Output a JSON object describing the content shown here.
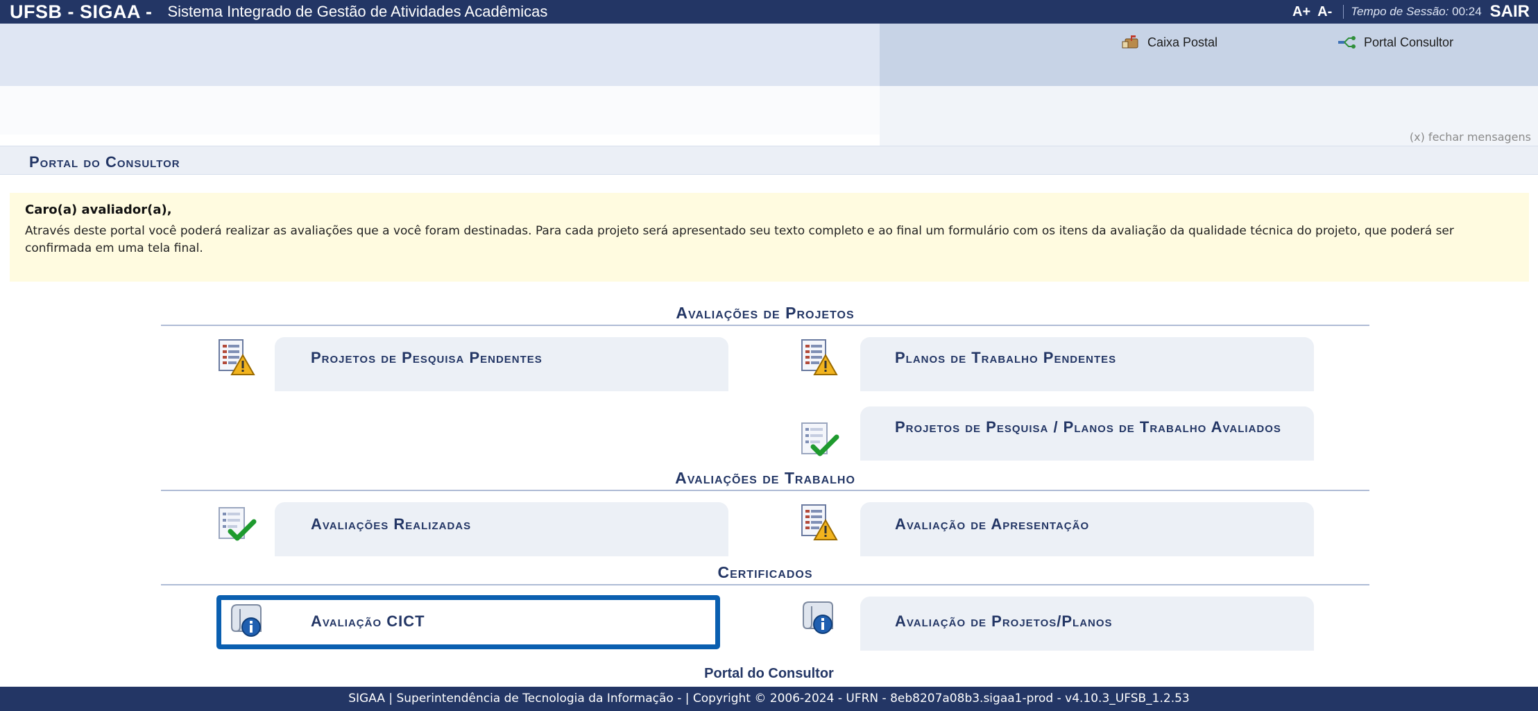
{
  "header": {
    "brand": "UFSB - SIGAA -",
    "system_name": "Sistema Integrado de Gestão de Atividades Acadêmicas",
    "font_increase": "A+",
    "font_decrease": "A-",
    "session_label": "Tempo de Sessão:",
    "session_time": "00:24",
    "logout": "SAIR"
  },
  "links": {
    "mailbox": "Caixa Postal",
    "portal": "Portal Consultor"
  },
  "messages": {
    "close": "(x) fechar mensagens"
  },
  "page": {
    "title": "Portal do Consultor"
  },
  "notice": {
    "title": "Caro(a) avaliador(a),",
    "text": "Através deste portal você poderá realizar as avaliações que a você foram destinadas. Para cada projeto será apresentado seu texto completo e ao final um formulário com os itens da avaliação da qualidade técnica do projeto, que poderá ser confirmada em uma tela final."
  },
  "sections": [
    {
      "title": "Avaliações de Projetos",
      "items": [
        {
          "label": "Projetos de Pesquisa Pendentes",
          "icon": "document-warning-icon"
        },
        {
          "label": "Planos de Trabalho Pendentes",
          "icon": "document-warning-icon"
        },
        {
          "label": "Projetos de Pesquisa / Planos de Trabalho Avaliados",
          "icon": "checklist-check-icon"
        }
      ]
    },
    {
      "title": "Avaliações de Trabalho",
      "items": [
        {
          "label": "Avaliações Realizadas",
          "icon": "checklist-check-icon"
        },
        {
          "label": "Avaliação de Apresentação",
          "icon": "document-warning-icon"
        }
      ]
    },
    {
      "title": "Certificados",
      "items": [
        {
          "label": "Avaliação CICT",
          "icon": "certificate-info-icon"
        },
        {
          "label": "Avaliação de Projetos/Planos",
          "icon": "certificate-info-icon"
        }
      ]
    }
  ],
  "footer": {
    "title": "Portal do Consultor",
    "text": "SIGAA | Superintendência de Tecnologia da Informação - | Copyright © 2006-2024 - UFRN - 8eb8207a08b3.sigaa1-prod - v4.10.3_UFSB_1.2.53"
  },
  "colors": {
    "primary": "#233665",
    "highlight": "#0a5fb0",
    "notice_bg": "#fffbe0"
  }
}
